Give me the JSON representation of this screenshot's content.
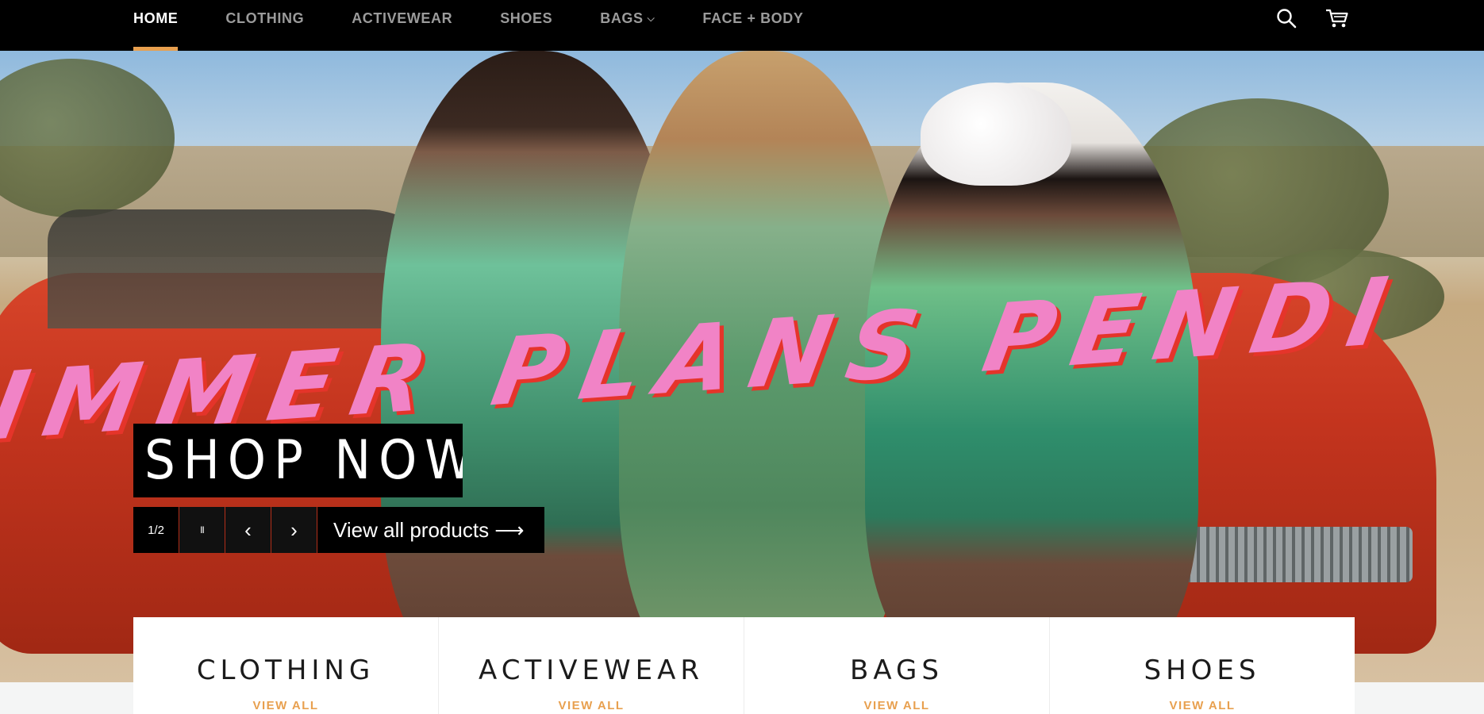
{
  "nav": {
    "items": [
      {
        "label": "HOME",
        "active": true
      },
      {
        "label": "CLOTHING"
      },
      {
        "label": "ACTIVEWEAR"
      },
      {
        "label": "SHOES"
      },
      {
        "label": "BAGS",
        "has_dropdown": true
      },
      {
        "label": "FACE + BODY"
      }
    ],
    "icons": [
      "search-icon",
      "cart-icon"
    ],
    "accent_color": "#e8a04f"
  },
  "hero": {
    "slogan": "IMMER PLANS PENDI",
    "cta_label": "SHOP NOW",
    "slideshow": {
      "index": "1/2",
      "pause_glyph": "II",
      "prev_glyph": "‹",
      "next_glyph": "›",
      "view_all_label": "View all products ⟶"
    }
  },
  "collections": [
    {
      "title": "CLOTHING",
      "link": "VIEW ALL"
    },
    {
      "title": "ACTIVEWEAR",
      "link": "VIEW ALL"
    },
    {
      "title": "BAGS",
      "link": "VIEW ALL"
    },
    {
      "title": "SHOES",
      "link": "VIEW ALL"
    }
  ]
}
